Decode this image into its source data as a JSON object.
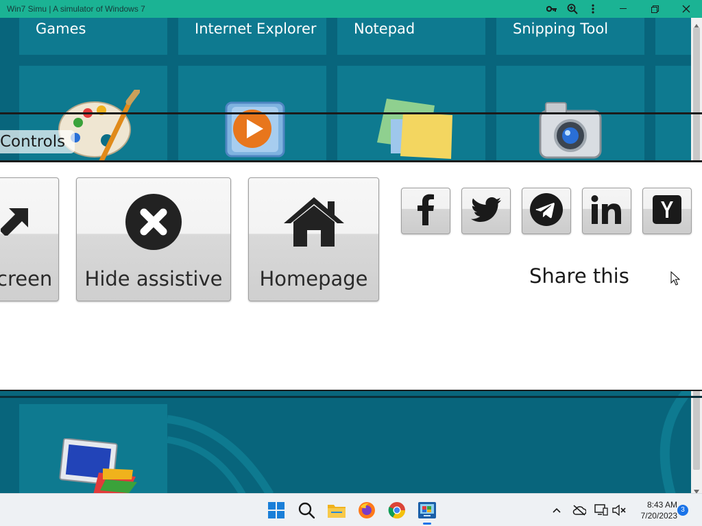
{
  "window": {
    "title": "Win7 Simu | A simulator of Windows 7",
    "icons": [
      "key-icon",
      "zoom-icon",
      "more-icon"
    ],
    "controls": [
      "minimize",
      "restore",
      "close"
    ]
  },
  "desktop": {
    "tiles": [
      {
        "label": "Games",
        "icon": "paint-palette-icon"
      },
      {
        "label": "Internet Explorer",
        "icon": "media-player-icon"
      },
      {
        "label": "Notepad",
        "icon": "sticky-notes-icon"
      },
      {
        "label": "Snipping Tool",
        "icon": "camera-icon"
      }
    ],
    "bottom_tile_icon": "display-color-icon"
  },
  "assistive": {
    "section_label": "Controls",
    "buttons": [
      {
        "label": "creen",
        "icon": "arrow-up-right-icon"
      },
      {
        "label": "Hide assistive",
        "icon": "close-circle-icon"
      },
      {
        "label": "Homepage",
        "icon": "home-icon"
      }
    ],
    "share": {
      "label": "Share this",
      "targets": [
        {
          "name": "facebook",
          "icon": "facebook-icon"
        },
        {
          "name": "twitter",
          "icon": "twitter-icon"
        },
        {
          "name": "telegram",
          "icon": "telegram-icon"
        },
        {
          "name": "linkedin",
          "icon": "linkedin-icon"
        },
        {
          "name": "hackernews",
          "icon": "y-combinator-icon"
        }
      ]
    }
  },
  "taskbar": {
    "apps": [
      "start-icon",
      "search-icon",
      "file-explorer-icon",
      "firefox-icon",
      "chrome-icon",
      "win7simu-icon"
    ],
    "clock_time": "8:43 AM",
    "clock_date": "7/20/2023",
    "notification_count": "3"
  },
  "colors": {
    "titlebar": "#1bb394",
    "desktop": "#08657c",
    "tile": "#148ca0",
    "panel": "#ffffff"
  }
}
